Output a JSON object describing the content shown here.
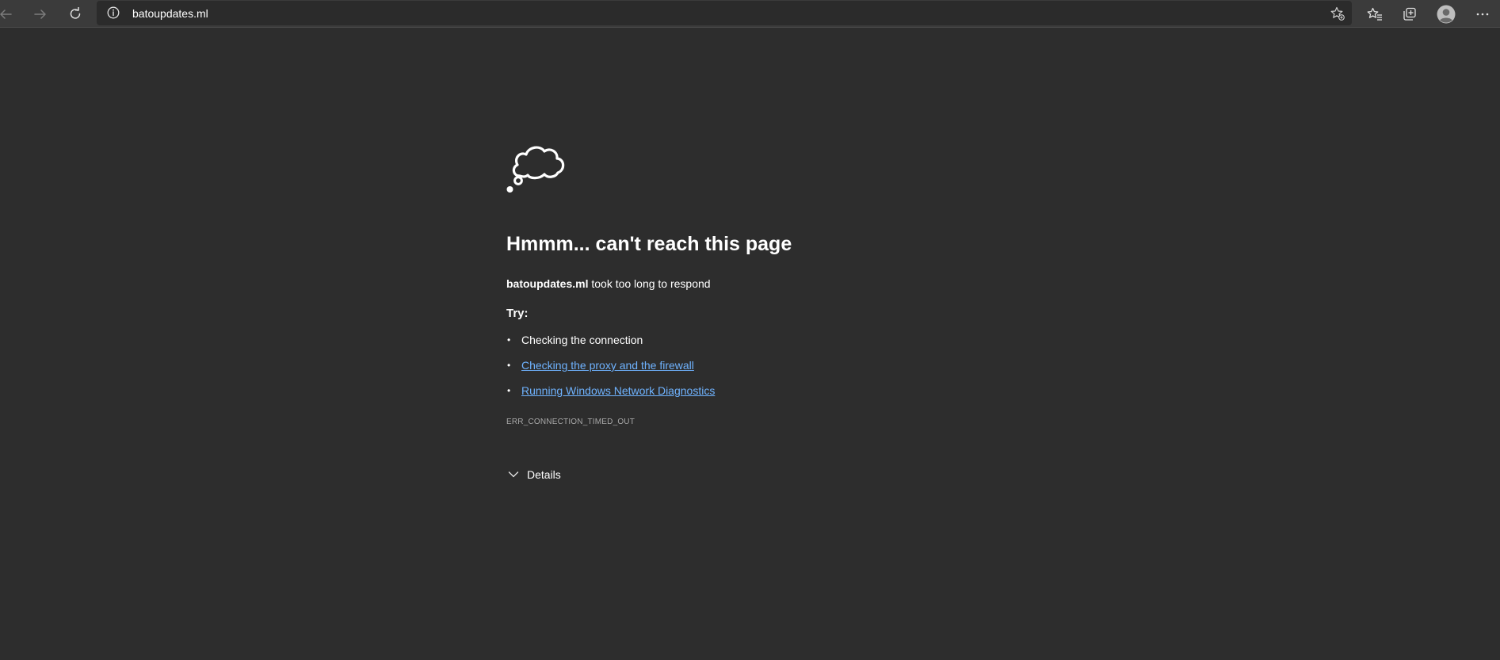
{
  "browser": {
    "url": "batoupdates.ml"
  },
  "error": {
    "headline": "Hmmm... can't reach this page",
    "host": "batoupdates.ml",
    "message": " took too long to respond",
    "try_label": "Try:",
    "suggestions": [
      {
        "text": "Checking the connection",
        "link": false
      },
      {
        "text": "Checking the proxy and the firewall",
        "link": true
      },
      {
        "text": "Running Windows Network Diagnostics",
        "link": true
      }
    ],
    "bullet": "•",
    "code": "ERR_CONNECTION_TIMED_OUT",
    "details_label": "Details"
  },
  "colors": {
    "page_bg": "#2d2d2d",
    "toolbar_bg": "#3b3b3b",
    "address_bg": "#2b2b2b",
    "link": "#6fb3ff",
    "muted": "#a8a8a8"
  }
}
